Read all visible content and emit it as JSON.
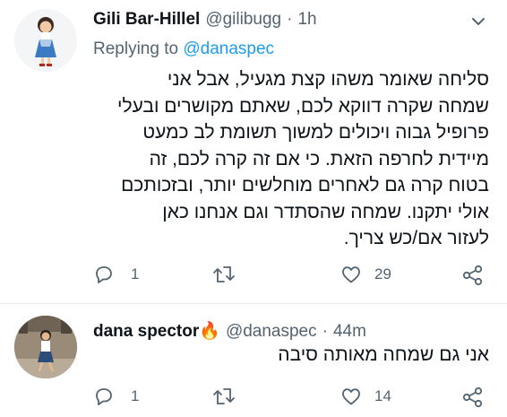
{
  "tweet1": {
    "name": "Gili Bar-Hillel",
    "handle": "@gilibugg",
    "dot": "·",
    "time": "1h",
    "replying_prefix": "Replying to",
    "replying_handle": "@danaspec",
    "lines": [
      "סליחה שאומר משהו קצת מגעיל, אבל אני",
      "שמחה שקרה דווקא לכם, שאתם מקושרים ובעלי",
      "פרופיל גבוה ויכולים למשוך תשומת לב כמעט",
      "מיידית לחרפה הזאת. כי אם זה קרה לכם, זה",
      "בטוח קרה גם לאחרים מוחלשים יותר, ובזכותכם",
      "אולי יתקנו. שמחה שהסתדר וגם אנחנו כאן",
      "לעזור אם/כש צריך."
    ],
    "reply_count": "1",
    "retweet_count": "",
    "like_count": "29"
  },
  "tweet2": {
    "name": "dana spector",
    "name_emoji": "🔥",
    "handle": "@danaspec",
    "dot": "·",
    "time": "44m",
    "text": "אני גם שמחה מאותה סיבה",
    "reply_count": "1",
    "retweet_count": "",
    "like_count": "14"
  },
  "colors": {
    "accent": "#1d9bf0",
    "muted": "#536471",
    "fire": "#f4900c"
  }
}
